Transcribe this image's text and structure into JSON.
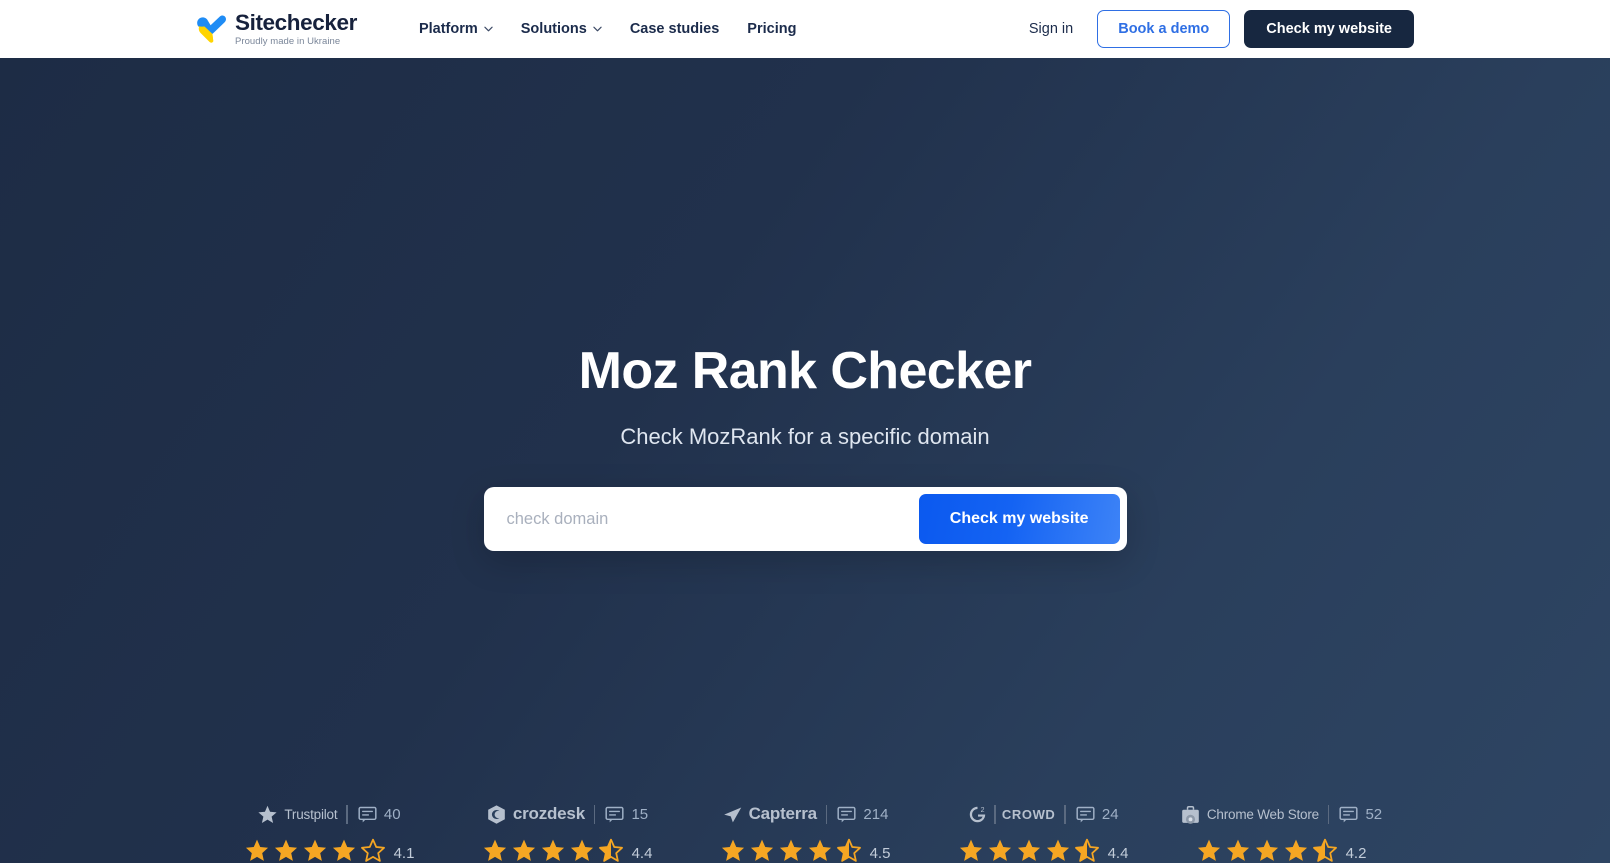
{
  "header": {
    "logo": {
      "icon": "ukraine-heart-check-icon",
      "word": "Sitechecker",
      "tagline": "Proudly made in Ukraine"
    },
    "nav": [
      {
        "label": "Platform",
        "has_dropdown": true,
        "icon": "chevron-down-icon"
      },
      {
        "label": "Solutions",
        "has_dropdown": true,
        "icon": "chevron-down-icon"
      },
      {
        "label": "Case studies",
        "has_dropdown": false
      },
      {
        "label": "Pricing",
        "has_dropdown": false
      }
    ],
    "sign_in": "Sign in",
    "book_demo": "Book a demo",
    "check_website": "Check my website"
  },
  "hero": {
    "title": "Moz Rank Checker",
    "subtitle": "Check MozRank for a specific domain",
    "search_placeholder": "check domain",
    "search_value": "",
    "submit_label": "Check my website"
  },
  "badges": [
    {
      "id": "trustpilot",
      "brand": "Trustpilot",
      "icon": "trustpilot-star-icon",
      "reviews": "40",
      "reviews_icon": "comment-icon",
      "rating": "4.1",
      "full_stars": 4,
      "half_star": false,
      "empty_stars": 1
    },
    {
      "id": "crozdesk",
      "brand": "crozdesk",
      "icon": "crozdesk-shield-icon",
      "reviews": "15",
      "reviews_icon": "comment-icon",
      "rating": "4.4",
      "full_stars": 4,
      "half_star": true,
      "empty_stars": 0
    },
    {
      "id": "capterra",
      "brand": "Capterra",
      "icon": "capterra-arrow-icon",
      "reviews": "214",
      "reviews_icon": "comment-icon",
      "rating": "4.5",
      "full_stars": 4,
      "half_star": true,
      "empty_stars": 0
    },
    {
      "id": "g2crowd",
      "brand": "CROWD",
      "icon": "g2-crowd-icon",
      "reviews": "24",
      "reviews_icon": "comment-icon",
      "rating": "4.4",
      "full_stars": 4,
      "half_star": true,
      "empty_stars": 0
    },
    {
      "id": "chrome-web-store",
      "brand": "Chrome Web Store",
      "icon": "chrome-web-store-icon",
      "reviews": "52",
      "reviews_icon": "comment-icon",
      "rating": "4.2",
      "full_stars": 4,
      "half_star": true,
      "empty_stars": 0
    }
  ],
  "colors": {
    "hero_bg_start": "#1d2c45",
    "hero_bg_end": "#2e4563",
    "accent_blue": "#2f6fe4",
    "cta_gradient_start": "#0b59ef",
    "cta_gradient_end": "#3d83f7",
    "dark_button": "#172740",
    "star_gold": "#f5a623",
    "logo_blue": "#1f8cf5",
    "logo_yellow": "#ffd400"
  }
}
